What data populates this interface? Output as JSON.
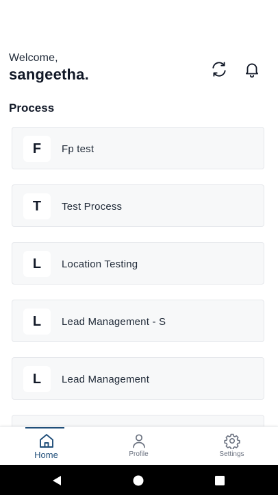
{
  "header": {
    "welcome_text": "Welcome,",
    "username": "sangeetha.",
    "refresh_icon": "refresh-icon",
    "notification_icon": "bell-icon"
  },
  "section": {
    "title": "Process"
  },
  "processes": [
    {
      "initial": "F",
      "name": "Fp test"
    },
    {
      "initial": "T",
      "name": "Test Process"
    },
    {
      "initial": "L",
      "name": "Location Testing"
    },
    {
      "initial": "L",
      "name": "Lead Management - S"
    },
    {
      "initial": "L",
      "name": "Lead Management"
    }
  ],
  "bottom_nav": {
    "items": [
      {
        "label": "Home",
        "icon": "home-icon",
        "active": true
      },
      {
        "label": "Profile",
        "icon": "person-icon",
        "active": false
      },
      {
        "label": "Settings",
        "icon": "gear-icon",
        "active": false
      }
    ]
  },
  "colors": {
    "accent": "#1f4e79",
    "card_background": "#f7f8f9",
    "card_border": "#e5e7eb",
    "text_primary": "#111827",
    "nav_inactive": "#6b7280"
  }
}
